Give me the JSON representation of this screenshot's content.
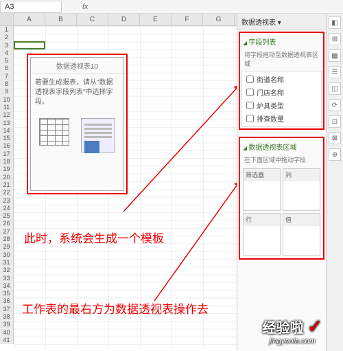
{
  "formula_bar": {
    "cell_ref": "A3",
    "fx_label": "fx"
  },
  "columns": [
    "A",
    "B",
    "C",
    "D",
    "E",
    "F",
    "G"
  ],
  "row_count": 41,
  "pivot_placeholder": {
    "title": "数据透视表10",
    "hint": "若要生成报表，请从\"数据透视表字段列表\"中选择字段。"
  },
  "annotations": {
    "a1": "此时，系统会生成一个模板",
    "a2": "工作表的最右方为数据透视表操作去"
  },
  "side_panel": {
    "header": "数据透视表 ▾",
    "fields": {
      "title": "字段列表",
      "sub": "将字段拖动至数据透视表区域",
      "items": [
        "街道名称",
        "门店名称",
        "炉具类型",
        "排查数量"
      ]
    },
    "areas": {
      "title": "数据透视表区域",
      "sub": "在下面区域中拖动字段",
      "cells": [
        "筛选器",
        "列",
        "行",
        "值"
      ]
    }
  },
  "watermark": {
    "line1": "经验啦",
    "line2": "jingyanla.com"
  }
}
